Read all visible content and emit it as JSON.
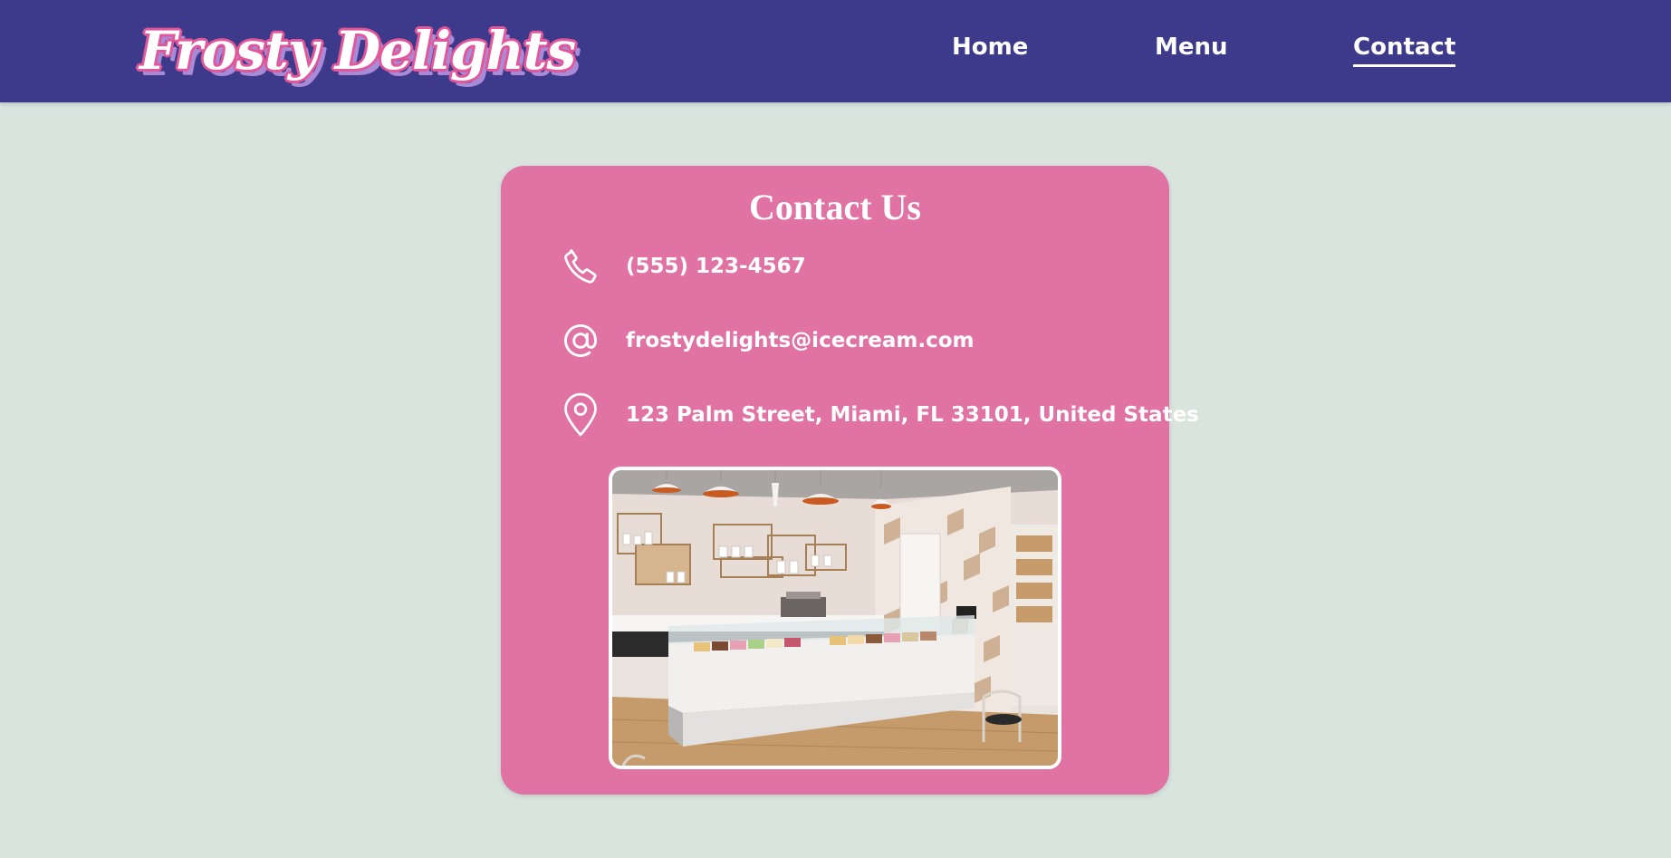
{
  "brand": {
    "logo_text": "Frosty Delights"
  },
  "nav": {
    "items": [
      {
        "label": "Home",
        "active": false
      },
      {
        "label": "Menu",
        "active": false
      },
      {
        "label": "Contact",
        "active": true
      }
    ]
  },
  "contact": {
    "title": "Contact Us",
    "phone": {
      "icon": "phone-icon",
      "value": "(555) 123-4567"
    },
    "email": {
      "icon": "at-sign-icon",
      "value": "frostydelights@icecream.com"
    },
    "address": {
      "icon": "map-pin-icon",
      "value": "123 Palm Street, Miami, FL 33101, United States"
    },
    "photo": {
      "subject": "ice cream shop interior with display counter"
    }
  },
  "colors": {
    "navbar": "#3d3a8c",
    "page_background": "#d9e4de",
    "card": "#e072a4",
    "logo_outline": "#e2579a",
    "logo_shadow": "#a98ad6",
    "text": "#ffffff"
  }
}
